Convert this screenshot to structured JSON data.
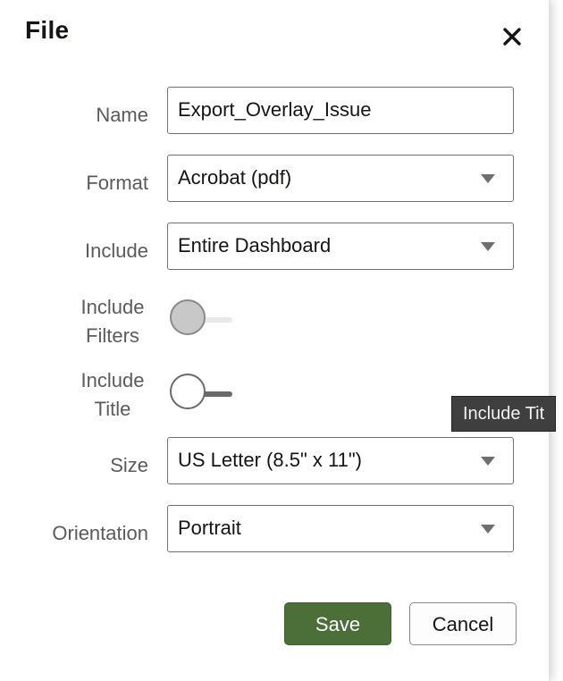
{
  "dialog": {
    "title": "File",
    "close_icon": "close-icon"
  },
  "form": {
    "name": {
      "label": "Name",
      "value": "Export_Overlay_Issue"
    },
    "format": {
      "label": "Format",
      "value": "Acrobat (pdf)"
    },
    "include": {
      "label": "Include",
      "value": "Entire Dashboard"
    },
    "include_filters": {
      "label_line1": "Include",
      "label_line2": "Filters",
      "state": "off",
      "disabled": true
    },
    "include_title": {
      "label_line1": "Include",
      "label_line2": "Title",
      "state": "off",
      "disabled": false
    },
    "size": {
      "label": "Size",
      "value": "US Letter (8.5\" x 11\")"
    },
    "orientation": {
      "label": "Orientation",
      "value": "Portrait"
    }
  },
  "tooltip": {
    "text": "Include Tit"
  },
  "buttons": {
    "save_label": "Save",
    "cancel_label": "Cancel"
  },
  "colors": {
    "save_bg": "#4c6f3a",
    "tooltip_bg": "#3f3f3f"
  }
}
